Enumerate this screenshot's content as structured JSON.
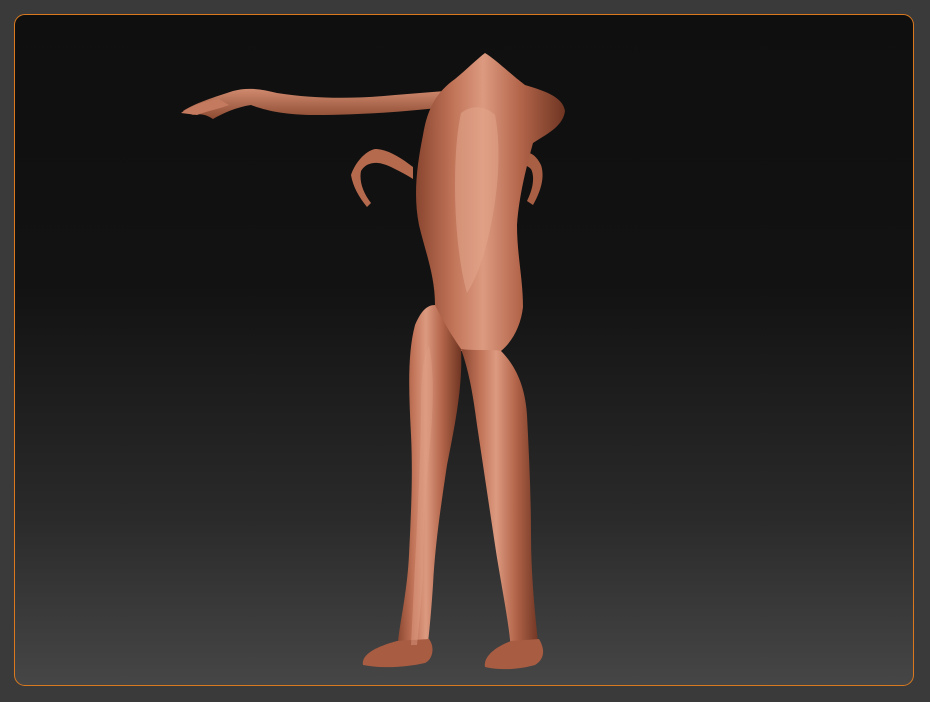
{
  "app": {
    "accent_color": "#d9791f",
    "background_color": "#3a3a3a"
  },
  "viewport": {
    "content": "mannequin-mesh",
    "mesh_color": "#b06448",
    "mesh_shadow_color": "#7a3f2a",
    "mesh_highlight_color": "#d9907a"
  }
}
